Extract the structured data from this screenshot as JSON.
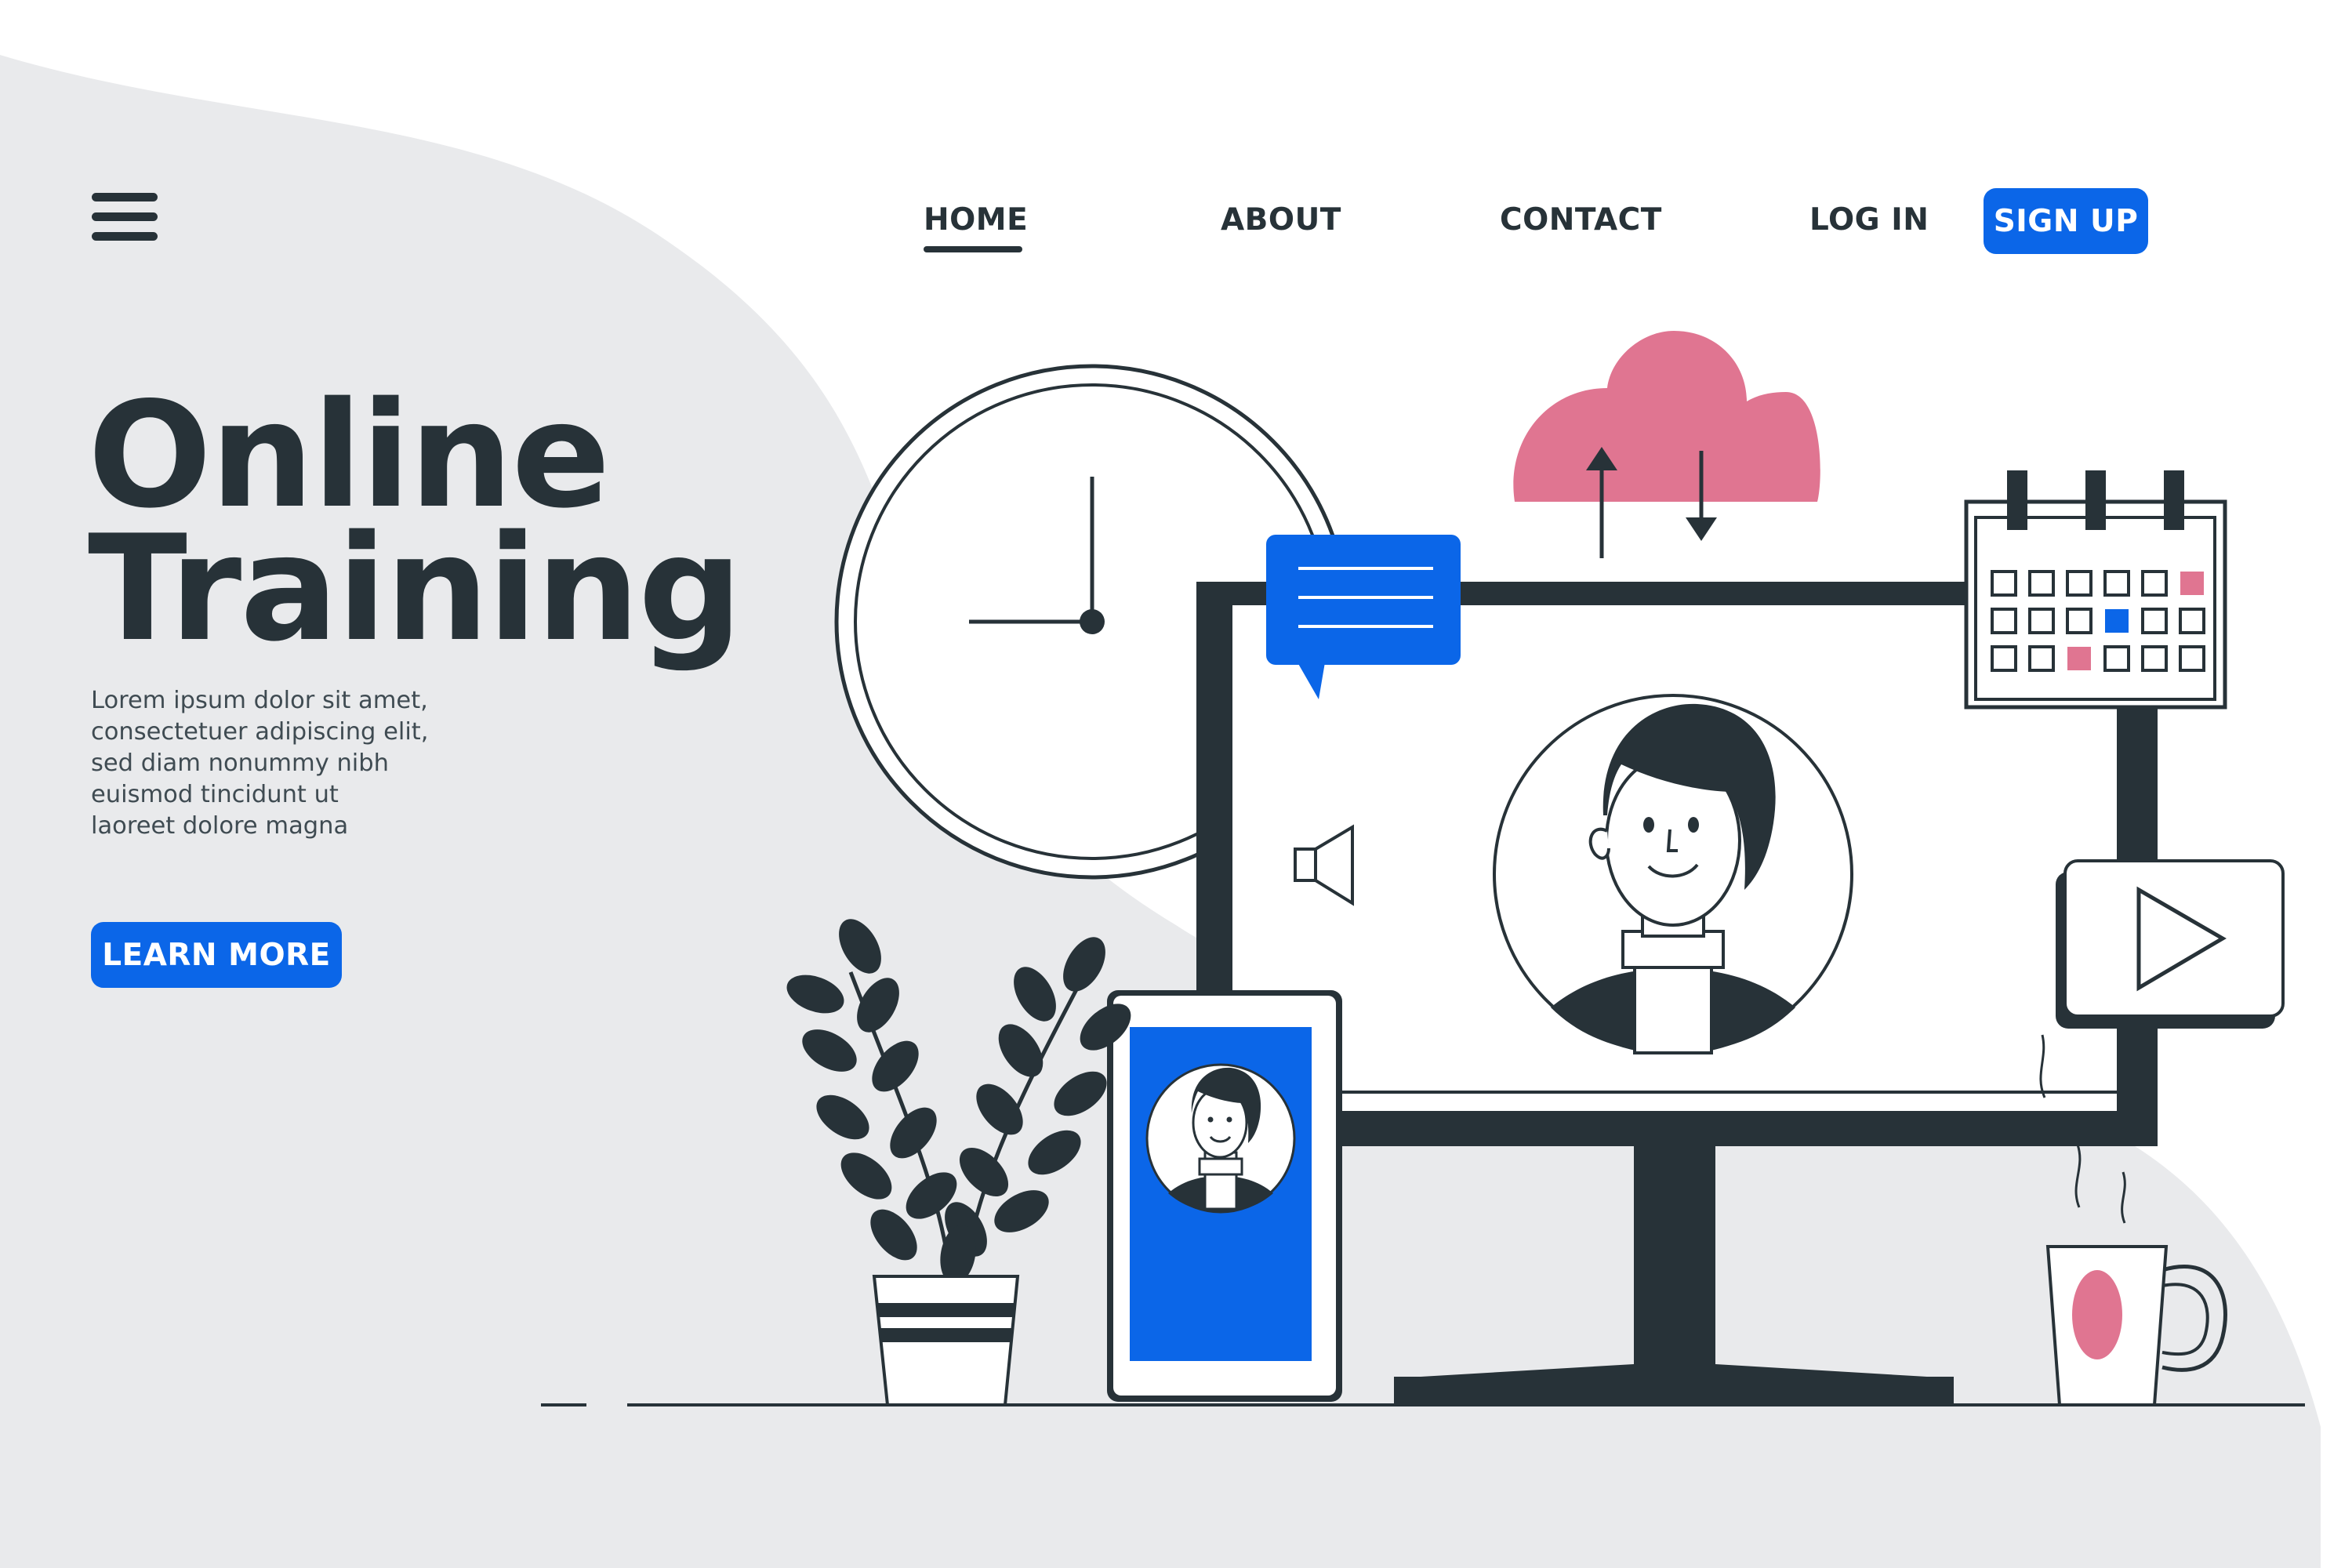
{
  "colors": {
    "accent": "#0b66e8",
    "pink": "#e07591",
    "dark": "#273238",
    "background_shape": "#e9eaec"
  },
  "header": {
    "menu_icon": "hamburger-menu-icon",
    "nav": [
      {
        "label": "HOME",
        "active": true
      },
      {
        "label": "ABOUT",
        "active": false
      },
      {
        "label": "CONTACT",
        "active": false
      },
      {
        "label": "LOG IN",
        "active": false
      }
    ],
    "signup_label": "SIGN UP"
  },
  "hero": {
    "title_line1": "Online",
    "title_line2": "Training",
    "description_lines": [
      "Lorem ipsum dolor sit amet,",
      "consectetuer adipiscing elit,",
      "sed diam nonummy nibh",
      "euismod tincidunt ut",
      "laoreet dolore magna"
    ],
    "cta_label": "LEARN MORE"
  },
  "illustration": {
    "icons": [
      "wall-clock-icon",
      "cloud-sync-icon",
      "chat-bubble-icon",
      "calendar-icon",
      "monitor-icon",
      "speaker-icon",
      "video-call-avatar-icon",
      "play-button-icon",
      "smartphone-icon",
      "potted-plant-icon",
      "coffee-mug-icon"
    ]
  }
}
